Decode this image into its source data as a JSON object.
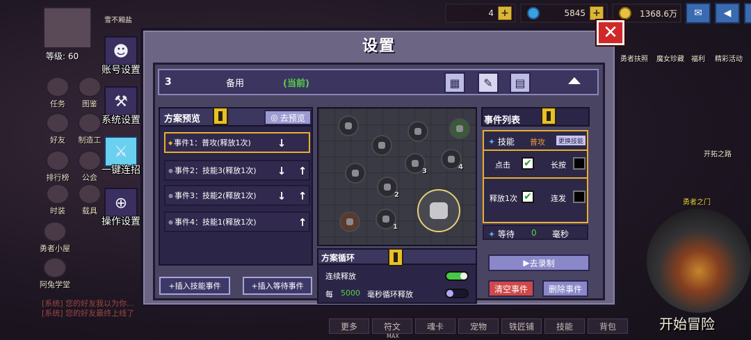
{
  "background": {
    "resources": [
      {
        "value": "4",
        "icon": "gem-icon"
      },
      {
        "value": "5845",
        "icon": "diamond-icon"
      },
      {
        "value": "1368.6万",
        "icon": "gold-coin-icon"
      }
    ],
    "level_text": "等级: 60",
    "left_menu": [
      "任务",
      "图鉴",
      "好友",
      "制造工",
      "排行榜",
      "公会",
      "时装",
      "载具",
      "勇者小屋",
      "阿兔学堂"
    ],
    "right_labels": [
      "勇者扶照",
      "魔女珍藏",
      "福利",
      "精彩活动",
      "开拓之路",
      "勇者之门"
    ],
    "chat_lines": [
      "[系统] 您的好友我以为你...",
      "[系统] 您的好友最终上线了"
    ],
    "start_button": "开始冒险",
    "bottom_tabs": [
      "更多",
      "符文",
      "魂卡",
      "宠物",
      "铁匠铺",
      "技能",
      "背包"
    ],
    "bottom_sub": "MAX",
    "top_banner": "雪不厢盐"
  },
  "side_tabs": [
    {
      "label": "账号设置",
      "icon": "skull-icon"
    },
    {
      "label": "系统设置",
      "icon": "wrench-icon"
    },
    {
      "label": "一键连招",
      "icon": "sword-icon",
      "active": true
    },
    {
      "label": "操作设置",
      "icon": "gamepad-icon"
    }
  ],
  "dialog": {
    "title": "设置",
    "close": "✕",
    "scheme": {
      "number": "3",
      "name": "备用",
      "current_tag": "(当前)"
    },
    "preview": {
      "title": "方案预览",
      "preview_button": "去预览",
      "events": [
        {
          "label": "事件1：普攻(释放1次)",
          "selected": true,
          "down": true,
          "up": false
        },
        {
          "label": "事件2：技能3(释放1次)",
          "selected": false,
          "down": true,
          "up": true
        },
        {
          "label": "事件3：技能2(释放1次)",
          "selected": false,
          "down": true,
          "up": true
        },
        {
          "label": "事件4：技能1(释放1次)",
          "selected": false,
          "down": false,
          "up": true
        }
      ],
      "add_skill_event": "插入技能事件",
      "add_wait_event": "插入等待事件"
    },
    "map_numbers": [
      "3",
      "4",
      "2",
      "1"
    ],
    "loop": {
      "title": "方案循环",
      "continuous_label": "连续释放",
      "continuous_on": true,
      "every_prefix": "每",
      "interval_value": "5000",
      "interval_suffix": "毫秒循环释放",
      "interval_on": false
    },
    "event_list": {
      "title": "事件列表",
      "type_label": "技能",
      "type_value": "普攻",
      "change_skill": "更换技能",
      "tap_label": "点击",
      "tap_checked": true,
      "hold_label": "长按",
      "hold_checked": false,
      "once_label": "释放1次",
      "once_checked": true,
      "repeat_label": "连发",
      "repeat_checked": false,
      "wait_label": "等待",
      "wait_value": "0",
      "wait_unit": "毫秒"
    },
    "record_button": "去录制",
    "clear_button": "清空事件",
    "delete_button": "删除事件"
  },
  "colors": {
    "accent": "#e8b030",
    "current_tag": "#58d048",
    "clear": "#d04848",
    "panel": "#2b2648"
  }
}
